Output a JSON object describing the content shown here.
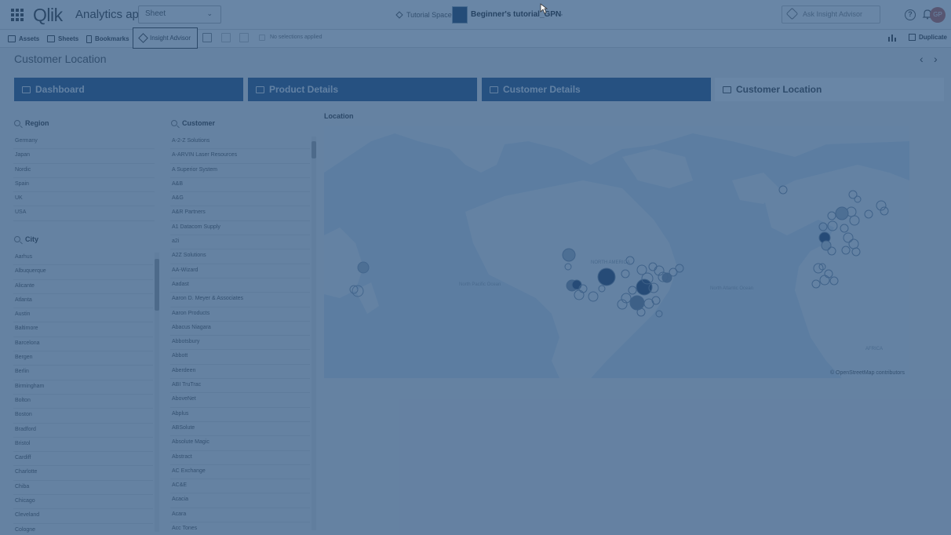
{
  "header": {
    "logo": "Qlik",
    "app_label": "Analytics app",
    "sheet_dropdown": "Sheet",
    "space": "Tutorial Space",
    "app_name": "Beginner's tutorial_GPN",
    "more": "···",
    "ask_placeholder": "Ask Insight Advisor",
    "help": "?",
    "avatar": "GP"
  },
  "toolbar": {
    "assets": "Assets",
    "sheets": "Sheets",
    "bookmarks": "Bookmarks",
    "insight_advisor": "Insight Advisor",
    "no_selections": "No selections applied",
    "duplicate": "Duplicate"
  },
  "sheet": {
    "title": "Customer Location",
    "prev": "‹",
    "next": "›",
    "tabs": [
      {
        "label": "Dashboard"
      },
      {
        "label": "Product Details"
      },
      {
        "label": "Customer Details"
      },
      {
        "label": "Customer Location",
        "active": true
      }
    ]
  },
  "filters": {
    "region": {
      "title": "Region",
      "items": [
        "Germany",
        "Japan",
        "Nordic",
        "Spain",
        "UK",
        "USA"
      ]
    },
    "city": {
      "title": "City",
      "items": [
        "Aarhus",
        "Albuquerque",
        "Alicante",
        "Atlanta",
        "Austin",
        "Baltimore",
        "Barcelona",
        "Bergen",
        "Berlin",
        "Birmingham",
        "Bolton",
        "Boston",
        "Bradford",
        "Bristol",
        "Cardiff",
        "Charlotte",
        "Chiba",
        "Chicago",
        "Cleveland",
        "Cologne"
      ]
    },
    "customer": {
      "title": "Customer",
      "items": [
        "A-2-Z Solutions",
        "A-ARVIN Laser Resources",
        "A Superior System",
        "A&B",
        "A&G",
        "A&R Partners",
        "A1 Datacom Supply",
        "a2i",
        "A2Z Solutions",
        "AA-Wizard",
        "Aadast",
        "Aaron D. Meyer & Associates",
        "Aaron Products",
        "Abacus Niagara",
        "Abbotsbury",
        "Abbott",
        "Aberdeen",
        "ABI TruTrac",
        "AboveNet",
        "Abplus",
        "ABSolute",
        "Absolute Magic",
        "Abstract",
        "AC Exchange",
        "AC&E",
        "Acacia",
        "Acara",
        "Acc Tones"
      ]
    }
  },
  "map": {
    "title": "Location",
    "labels": {
      "north_america": "NORTH AMERICA",
      "north_pacific": "North Pacific Ocean",
      "north_atlantic": "North Atlantic Ocean",
      "africa": "AFRICA"
    },
    "attribution": "© OpenStreetMap contributors"
  },
  "colors": {
    "tab_bg": "#2f5b8d",
    "overlay": "rgba(34,76,124,0.68)",
    "avatar": "#c8695e"
  }
}
